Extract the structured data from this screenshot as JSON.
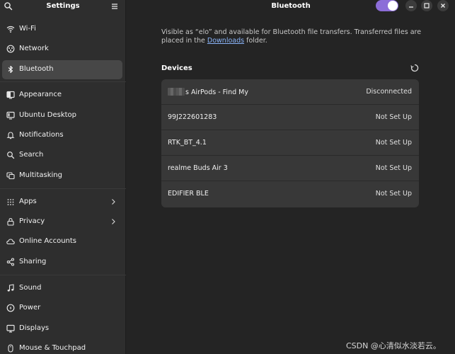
{
  "sidebar": {
    "title": "Settings",
    "items": [
      {
        "label": "Wi-Fi",
        "icon": "wifi-icon"
      },
      {
        "label": "Network",
        "icon": "network-icon"
      },
      {
        "label": "Bluetooth",
        "icon": "bluetooth-icon"
      },
      {
        "label": "Appearance",
        "icon": "appearance-icon"
      },
      {
        "label": "Ubuntu Desktop",
        "icon": "desktop-icon"
      },
      {
        "label": "Notifications",
        "icon": "bell-icon"
      },
      {
        "label": "Search",
        "icon": "search-icon"
      },
      {
        "label": "Multitasking",
        "icon": "multitasking-icon"
      },
      {
        "label": "Apps",
        "icon": "apps-grid-icon"
      },
      {
        "label": "Privacy",
        "icon": "lock-icon"
      },
      {
        "label": "Online Accounts",
        "icon": "cloud-icon"
      },
      {
        "label": "Sharing",
        "icon": "share-icon"
      },
      {
        "label": "Sound",
        "icon": "music-note-icon"
      },
      {
        "label": "Power",
        "icon": "power-icon"
      },
      {
        "label": "Displays",
        "icon": "display-icon"
      },
      {
        "label": "Mouse & Touchpad",
        "icon": "mouse-icon"
      }
    ],
    "active_item": "Bluetooth"
  },
  "main": {
    "title": "Bluetooth",
    "bluetooth_enabled": true,
    "info_text_before": "Visible as “elo” and available for Bluetooth file transfers. Transferred files are placed in the ",
    "info_link": "Downloads",
    "info_text_after": " folder.",
    "devices_heading": "Devices",
    "devices": [
      {
        "name": "s AirPods - Find My",
        "status": "Disconnected"
      },
      {
        "name": "99J222601283",
        "status": "Not Set Up"
      },
      {
        "name": "RTK_BT_4.1",
        "status": "Not Set Up"
      },
      {
        "name": "realme Buds Air 3",
        "status": "Not Set Up"
      },
      {
        "name": "EDIFIER BLE",
        "status": "Not Set Up"
      }
    ]
  },
  "colors": {
    "accent": "#8c6dd8",
    "sidebar_bg": "#2e2e2e",
    "main_bg": "#242424",
    "list_bg": "#383838",
    "link": "#8ab4f8"
  },
  "watermark": "CSDN @心清似水淡若云。"
}
